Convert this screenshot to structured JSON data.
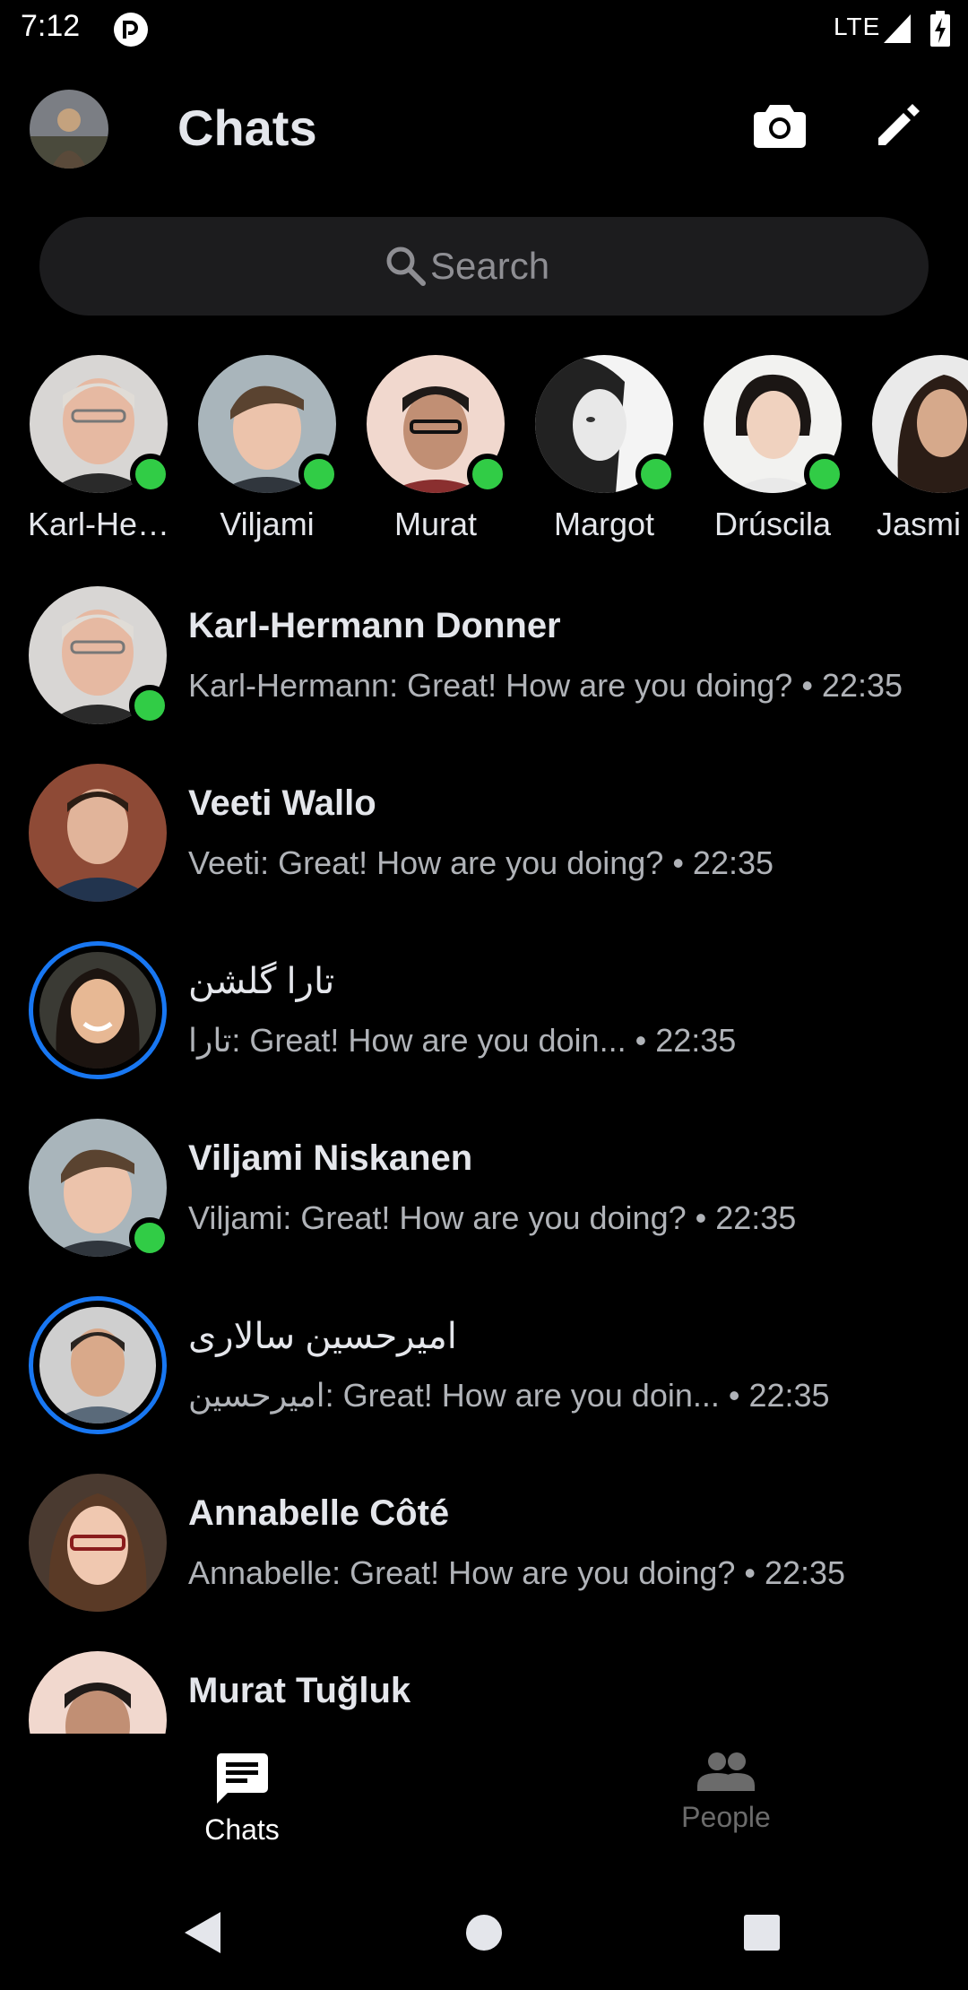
{
  "status_bar": {
    "time": "7:12",
    "network": "LTE"
  },
  "header": {
    "title": "Chats"
  },
  "search": {
    "placeholder": "Search"
  },
  "stories": [
    {
      "name": "Karl-He…",
      "online": true
    },
    {
      "name": "Viljami",
      "online": true
    },
    {
      "name": "Murat",
      "online": true
    },
    {
      "name": "Margot",
      "online": true
    },
    {
      "name": "Drúscila",
      "online": true
    },
    {
      "name": "Jasmi",
      "online": false
    }
  ],
  "chats": [
    {
      "name": "Karl-Hermann Donner",
      "preview": "Karl-Hermann: Great! How are you doing? • 22:35",
      "online": true,
      "story_ring": false
    },
    {
      "name": "Veeti Wallo",
      "preview": "Veeti: Great! How are you doing? • 22:35",
      "online": false,
      "story_ring": false
    },
    {
      "name": "تارا گلشن",
      "preview": "تارا: Great! How are you doin...  • 22:35",
      "online": false,
      "story_ring": true
    },
    {
      "name": "Viljami Niskanen",
      "preview": "Viljami: Great! How are you doing? • 22:35",
      "online": true,
      "story_ring": false
    },
    {
      "name": "امیرحسین سالاری",
      "preview": "امیرحسین: Great! How are you doin...  • 22:35",
      "online": false,
      "story_ring": true
    },
    {
      "name": "Annabelle Côté",
      "preview": "Annabelle: Great! How are you doing? • 22:35",
      "online": false,
      "story_ring": false
    },
    {
      "name": "Murat Tuğluk",
      "preview": "",
      "online": false,
      "story_ring": false
    }
  ],
  "bottom_nav": {
    "chats_label": "Chats",
    "people_label": "People"
  },
  "colors": {
    "online": "#31cc46",
    "story_ring": "#1877f2",
    "background": "#000000"
  }
}
